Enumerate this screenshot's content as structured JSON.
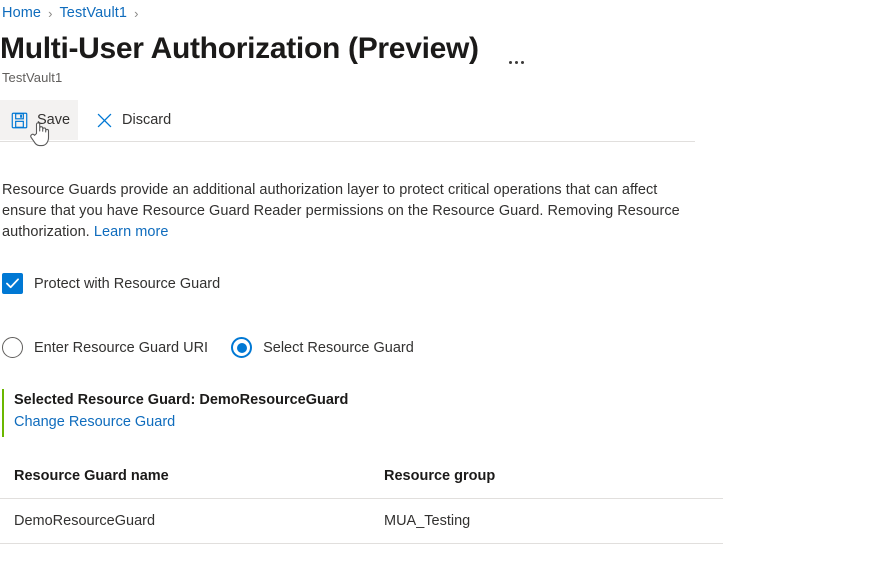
{
  "breadcrumb": {
    "items": [
      {
        "label": "Home"
      },
      {
        "label": "TestVault1"
      }
    ],
    "separator": "›"
  },
  "header": {
    "title": "Multi-User Authorization (Preview)",
    "subtitle": "TestVault1",
    "more_menu_icon": "ellipsis-icon"
  },
  "toolbar": {
    "save_label": "Save",
    "save_icon": "save-floppy-icon",
    "discard_label": "Discard",
    "discard_icon": "close-x-icon"
  },
  "description": {
    "part1": "Resource Guards provide an additional authorization layer to protect critical operations that can affect ensure that you have Resource Guard Reader permissions on the Resource Guard. Removing Resource authorization. ",
    "link_label": "Learn more"
  },
  "protect_checkbox": {
    "label": "Protect with Resource Guard",
    "checked": true,
    "icon": "checkmark-icon"
  },
  "guard_mode": {
    "options": [
      {
        "label": "Enter Resource Guard URI",
        "selected": false
      },
      {
        "label": "Select Resource Guard",
        "selected": true
      }
    ]
  },
  "selected_guard": {
    "title": "Selected Resource Guard: DemoResourceGuard",
    "change_link": "Change Resource Guard"
  },
  "table": {
    "columns": [
      "Resource Guard name",
      "Resource group"
    ],
    "rows": [
      {
        "name": "DemoResourceGuard",
        "group": "MUA_Testing"
      }
    ]
  },
  "colors": {
    "accent_blue": "#0078d4",
    "link_blue": "#0f6cbd",
    "success_green": "#6bb700",
    "hover_gray": "#f3f2f1",
    "divider": "#e1dfdd"
  },
  "cursor": {
    "icon": "hand-pointer-cursor"
  }
}
